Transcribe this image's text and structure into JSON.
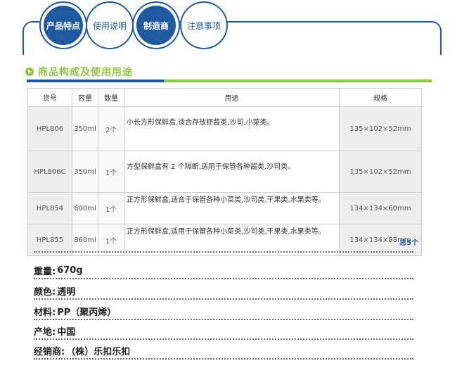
{
  "tabs": [
    {
      "label": "产品特点",
      "active": true
    },
    {
      "label": "使用说明",
      "active": false
    },
    {
      "label": "制造商",
      "active": true
    },
    {
      "label": "注意事项",
      "active": false
    }
  ],
  "section": {
    "title": "商品构成及使用用途"
  },
  "table": {
    "headers": [
      "货号",
      "容量",
      "数量",
      "用途",
      "规格"
    ],
    "rows": [
      {
        "code": "HPL806",
        "capacity": "350ml",
        "qty": "2个",
        "use": "小长方形保鲜盒,适合存放虾酱类,沙司,小菜类。",
        "size": "135×102×52mm"
      },
      {
        "code": "HPL806C",
        "capacity": "350ml",
        "qty": "1个",
        "use": "方型保鲜盒有 2 个隔断,适用于保管各种酱类,沙司类。",
        "size": "135×102×52mm"
      },
      {
        "code": "HPL854",
        "capacity": "600ml",
        "qty": "1个",
        "use": "正方形保鲜盒,适合于保管各种小菜类,沙司类,干果类,水果类等。",
        "size": "134×134×60mm"
      },
      {
        "code": "HPL855",
        "capacity": "860ml",
        "qty": "1个",
        "use": "正方形保鲜盒,适用于保管各种小菜类,沙司类,干果类,水果类等。",
        "size": "134×134×88mm"
      }
    ],
    "total": "总5个"
  },
  "info": [
    {
      "key": "重量:",
      "value": "670g"
    },
    {
      "key": "颜色:",
      "value": "透明"
    },
    {
      "key": "材料:",
      "value": "PP（聚丙烯）"
    },
    {
      "key": "产地:",
      "value": "中国"
    },
    {
      "key": "经销商:",
      "value": "（株）乐扣乐扣"
    }
  ],
  "colors": {
    "primary_blue": "#1f5aa0",
    "accent_green": "#8cc63f"
  }
}
